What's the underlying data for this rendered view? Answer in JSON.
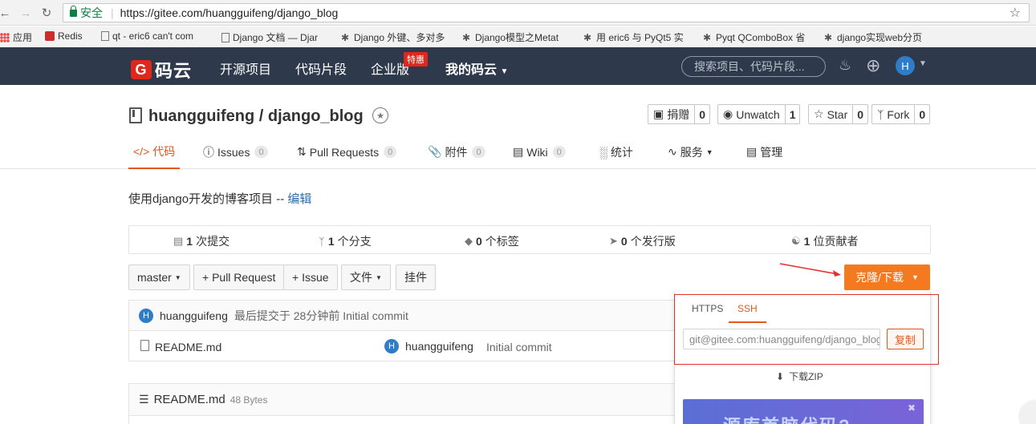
{
  "browser": {
    "secure_label": "安全",
    "url": "https://gitee.com/huangguifeng/django_blog"
  },
  "bookmarks": [
    {
      "label": "应用"
    },
    {
      "label": "Redis"
    },
    {
      "label": "qt - eric6 can't com"
    },
    {
      "label": "Django 文档 — Djar"
    },
    {
      "label": "Django 外键、多对多"
    },
    {
      "label": "Django模型之Metat"
    },
    {
      "label": "用 eric6 与 PyQt5 实"
    },
    {
      "label": "Pyqt QComboBox 省"
    },
    {
      "label": "django实现web分页"
    }
  ],
  "site": {
    "logo_text": "码云",
    "logo_glyph": "G",
    "nav": [
      "开源项目",
      "代码片段",
      "企业版",
      "我的码云"
    ],
    "enterprise_badge": "特惠",
    "search_placeholder": "搜索项目、代码片段...",
    "avatar_letter": "H"
  },
  "repo": {
    "title": "huangguifeng / django_blog",
    "actions": [
      {
        "label": "捐赠",
        "count": "0"
      },
      {
        "label": "Unwatch",
        "count": "1"
      },
      {
        "label": "Star",
        "count": "0"
      },
      {
        "label": "Fork",
        "count": "0"
      }
    ],
    "tabs": [
      {
        "label": "代码",
        "count": ""
      },
      {
        "label": "Issues",
        "count": "0"
      },
      {
        "label": "Pull Requests",
        "count": "0"
      },
      {
        "label": "附件",
        "count": "0"
      },
      {
        "label": "Wiki",
        "count": "0"
      },
      {
        "label": "统计",
        "count": ""
      },
      {
        "label": "服务",
        "count": ""
      },
      {
        "label": "管理",
        "count": ""
      }
    ],
    "description": "使用django开发的博客项目 -- ",
    "edit_link": "编辑"
  },
  "stats": [
    {
      "num": "1",
      "label": "次提交"
    },
    {
      "num": "1",
      "label": "个分支"
    },
    {
      "num": "0",
      "label": "个标签"
    },
    {
      "num": "0",
      "label": "个发行版"
    },
    {
      "num": "1",
      "label": "位贡献者"
    }
  ],
  "toolbar": {
    "branch": "master",
    "pull_request": "+ Pull Request",
    "issue": "+ Issue",
    "file": "文件",
    "plugin": "挂件",
    "clone": "克隆/下载"
  },
  "commit": {
    "author": "huangguifeng",
    "meta": "最后提交于 28分钟前 Initial commit",
    "avatar_letter": "H"
  },
  "files": [
    {
      "name": "README.md",
      "author": "huangguifeng",
      "message": "Initial commit"
    }
  ],
  "readme": {
    "title": "README.md",
    "size": "48 Bytes"
  },
  "clone_panel": {
    "tabs": [
      "HTTPS",
      "SSH"
    ],
    "active_tab": "SSH",
    "url": "git@gitee.com:huangguifeng/django_blog.git",
    "copy_label": "复制",
    "zip_label": "下载ZIP",
    "promo_text": "源库首脑代码?"
  },
  "colors": {
    "accent": "#f57a1f",
    "header_bg": "#2e3a4b",
    "brand_red": "#e1271c",
    "link": "#2f6fab"
  }
}
